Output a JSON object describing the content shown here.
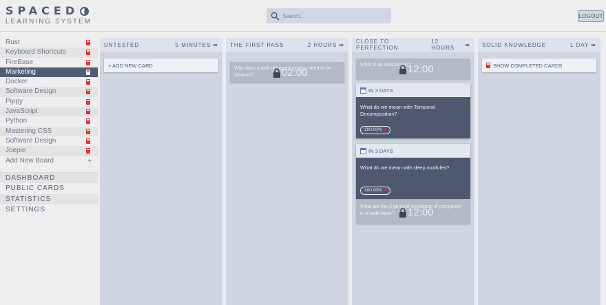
{
  "app": {
    "logo_title": "SPACED",
    "logo_subtitle": "LEARNING SYSTEM"
  },
  "header": {
    "search_placeholder": "Search...",
    "logout_label": "LOGOUT"
  },
  "sidebar": {
    "boards": [
      {
        "label": "Rust",
        "active": false
      },
      {
        "label": "Keyboard Shortcuts",
        "active": false
      },
      {
        "label": "FireBase",
        "active": false
      },
      {
        "label": "Marketing",
        "active": true
      },
      {
        "label": "Docker",
        "active": false
      },
      {
        "label": "Software Design",
        "active": false
      },
      {
        "label": "Pippy",
        "active": false
      },
      {
        "label": "JavaScript",
        "active": false
      },
      {
        "label": "Python",
        "active": false
      },
      {
        "label": "Mastering CSS",
        "active": false
      },
      {
        "label": "Software Design",
        "active": false
      },
      {
        "label": "Joepie",
        "active": false
      }
    ],
    "add_board_label": "Add New Board",
    "add_board_icon": "+",
    "nav": [
      {
        "label": "DASHBOARD"
      },
      {
        "label": "PUBLIC CARDS"
      },
      {
        "label": "STATISTICS"
      },
      {
        "label": "SETTINGS"
      }
    ]
  },
  "columns": [
    {
      "title": "UNTESTED",
      "interval": "5 MINUTES",
      "add_card_label": "+ ADD NEW CARD"
    },
    {
      "title": "THE FIRST PASS",
      "interval": "2 HOURS",
      "locked_cards": [
        {
          "text": "Why does a well-designed system need to be obvious?",
          "time": "02:00"
        }
      ]
    },
    {
      "title": "CLOSE TO PERFECTION",
      "interval": "12 HOURS",
      "locked_cards": [
        {
          "text": "What is an Abstraction?",
          "time": "12:00"
        },
        {
          "text": "What are the 3 general symptoms of complexity in a code-base?",
          "time": "12:00"
        }
      ],
      "cards": [
        {
          "due": "IN 3 DAYS",
          "question": "What do we mean with Temporal Decomposition?",
          "score": "100.00%"
        },
        {
          "due": "IN 3 DAYS",
          "question": "What do we mean with deep modules?",
          "score": "100.00%"
        }
      ]
    },
    {
      "title": "SOLID KNOWLEDGE",
      "interval": "1 DAY",
      "show_completed_label": "SHOW COMPLETED CARDS"
    }
  ],
  "icons": {
    "search": "search-icon",
    "lock": "lock-icon",
    "calendar": "calendar-icon",
    "heart": "heart-icon",
    "bookmark": "bookmark-icon",
    "arrow": "arrow-right-icon"
  },
  "colors": {
    "accent": "#525c79",
    "column_bg": "#cfd6e2",
    "card_body": "#4f586f",
    "bookmark_red": "#e03434"
  }
}
